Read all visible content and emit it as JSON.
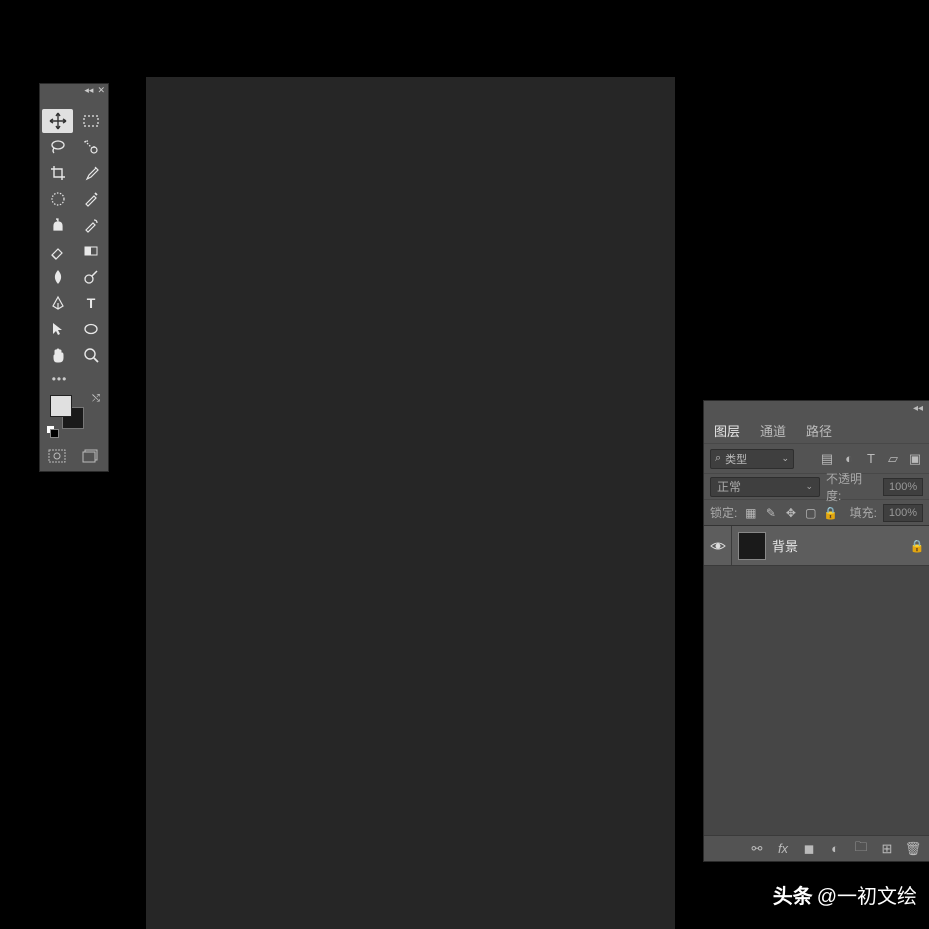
{
  "tools_panel": {
    "collapse": "◂◂",
    "close": "✕",
    "tools": [
      {
        "name": "move-tool",
        "selected": true
      },
      {
        "name": "marquee-tool",
        "selected": false
      },
      {
        "name": "lasso-tool",
        "selected": false
      },
      {
        "name": "quick-select-tool",
        "selected": false
      },
      {
        "name": "crop-tool",
        "selected": false
      },
      {
        "name": "eyedropper-tool",
        "selected": false
      },
      {
        "name": "frame-tool",
        "selected": false
      },
      {
        "name": "healing-brush-tool",
        "selected": false
      },
      {
        "name": "clone-stamp-tool",
        "selected": false
      },
      {
        "name": "history-brush-tool",
        "selected": false
      },
      {
        "name": "eraser-tool",
        "selected": false
      },
      {
        "name": "gradient-tool",
        "selected": false
      },
      {
        "name": "blur-tool",
        "selected": false
      },
      {
        "name": "dodge-tool",
        "selected": false
      },
      {
        "name": "pen-tool",
        "selected": false
      },
      {
        "name": "type-tool",
        "selected": false
      },
      {
        "name": "path-select-tool",
        "selected": false
      },
      {
        "name": "shape-tool",
        "selected": false
      },
      {
        "name": "hand-tool",
        "selected": false
      },
      {
        "name": "zoom-tool",
        "selected": false
      }
    ],
    "more": "•••",
    "fg_color": "#e0e0e0",
    "bg_color": "#1a1a1a"
  },
  "layers_panel": {
    "tabs": [
      {
        "label": "图层",
        "active": true
      },
      {
        "label": "通道",
        "active": false
      },
      {
        "label": "路径",
        "active": false
      }
    ],
    "filter_label": "类型",
    "blend_mode": "正常",
    "opacity_label": "不透明度:",
    "opacity_value": "100%",
    "lock_label": "锁定:",
    "fill_label": "填充:",
    "fill_value": "100%",
    "layers": [
      {
        "name": "背景",
        "visible": true,
        "locked": true
      }
    ],
    "collapse": "◂◂"
  },
  "watermark": {
    "logo": "头条",
    "text": "@一初文绘"
  }
}
